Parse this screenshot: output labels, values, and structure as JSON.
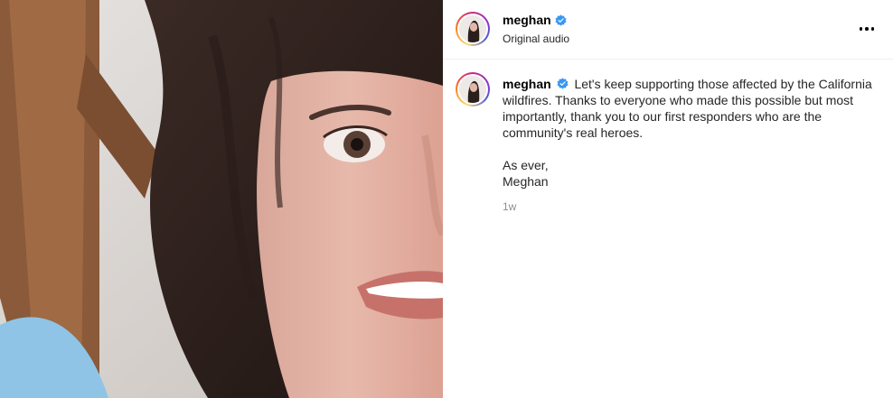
{
  "header": {
    "username": "meghan",
    "subtitle": "Original audio",
    "more_icon": "more-horizontal-icon"
  },
  "post": {
    "username": "meghan",
    "caption_text": "Let's keep supporting those affected by the California wildfires. Thanks to everyone who made this possible but most importantly, thank you to our first responders who are the community's real heroes.",
    "signoff_line1": "As ever,",
    "signoff_line2": "Meghan",
    "timestamp": "1w"
  },
  "colors": {
    "verified_blue": "#3897f0",
    "text": "#262626",
    "muted": "#8e8e8e"
  }
}
